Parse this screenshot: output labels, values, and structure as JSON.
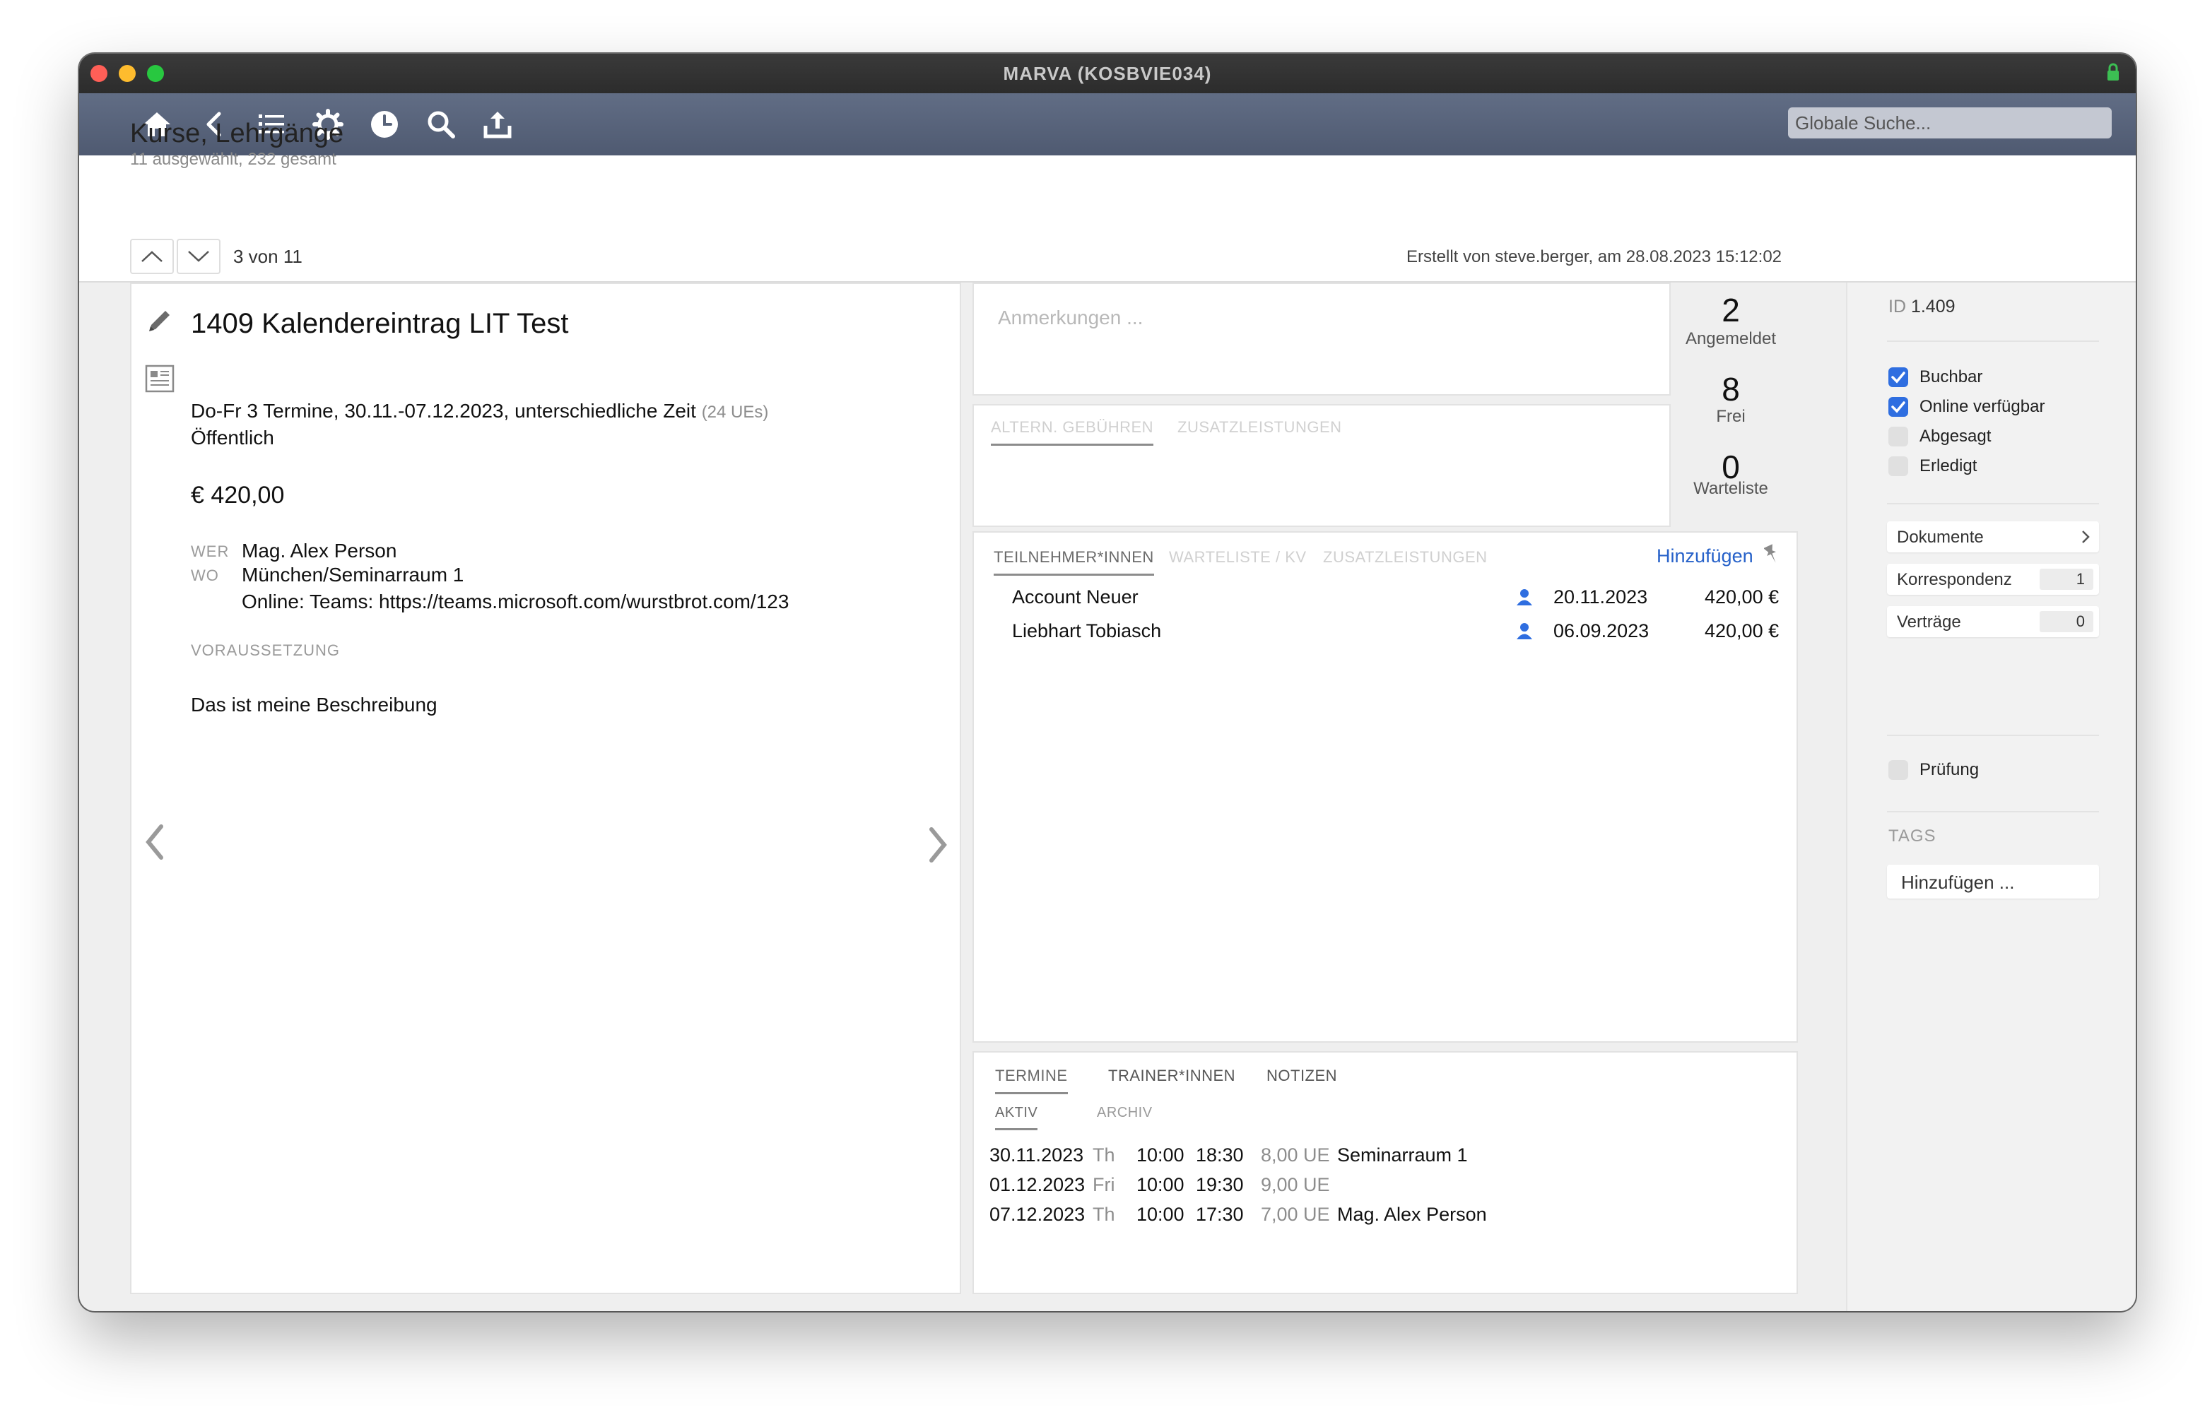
{
  "window": {
    "title": "MARVA (KOSBVIE034)"
  },
  "toolbar": {
    "icons": [
      "home-icon",
      "back-icon",
      "list-icon",
      "gear-icon",
      "clock-icon",
      "search-icon",
      "export-icon"
    ],
    "search_placeholder": "Globale Suche..."
  },
  "header": {
    "title": "Kurse, Lehrgänge",
    "subtitle": "11 ausgewählt, 232 gesamt"
  },
  "nav": {
    "position": "3 von 11",
    "created_by": "Erstellt von steve.berger, am 28.08.2023 15:12:02"
  },
  "course": {
    "title": "1409 Kalendereintrag LIT Test",
    "schedule": "Do-Fr 3 Termine, 30.11.-07.12.2023, unterschiedliche Zeit",
    "units": "(24 UEs)",
    "visibility": "Öffentlich",
    "price": "€ 420,00",
    "wer_label": "WER",
    "wer_value": "Mag. Alex Person",
    "wo_label": "WO",
    "wo_value": "München/Seminarraum 1",
    "online": "Online: Teams: https://teams.microsoft.com/wurstbrot.com/123",
    "prereq_label": "VORAUSSETZUNG",
    "description": "Das ist meine Beschreibung"
  },
  "notes": {
    "placeholder": "Anmerkungen ..."
  },
  "fees_tabs": [
    "ALTERN. GEBÜHREN",
    "ZUSATZLEISTUNGEN"
  ],
  "stats": [
    {
      "value": "2",
      "label": "Angemeldet"
    },
    {
      "value": "8",
      "label": "Frei"
    },
    {
      "value": "0",
      "label": "Warteliste"
    }
  ],
  "participants": {
    "tabs": [
      "TEILNEHMER*INNEN",
      "WARTELISTE / KV",
      "ZUSATZLEISTUNGEN"
    ],
    "add_label": "Hinzufügen",
    "rows": [
      {
        "name": "Account Neuer",
        "date": "20.11.2023",
        "amount": "420,00 €"
      },
      {
        "name": "Liebhart Tobiasch",
        "date": "06.09.2023",
        "amount": "420,00 €"
      }
    ]
  },
  "appointments": {
    "tabs": [
      "TERMINE",
      "TRAINER*INNEN",
      "NOTIZEN"
    ],
    "subtabs": [
      "AKTIV",
      "ARCHIV"
    ],
    "rows": [
      {
        "date": "30.11.2023",
        "day": "Th",
        "start": "10:00",
        "end": "18:30",
        "units": "8,00 UE",
        "info": "Seminarraum 1"
      },
      {
        "date": "01.12.2023",
        "day": "Fri",
        "start": "10:00",
        "end": "19:30",
        "units": "9,00 UE",
        "info": ""
      },
      {
        "date": "07.12.2023",
        "day": "Th",
        "start": "10:00",
        "end": "17:30",
        "units": "7,00 UE",
        "info": "Mag. Alex Person"
      }
    ]
  },
  "sidebar": {
    "id_label": "ID",
    "id_value": "1.409",
    "checkboxes": [
      {
        "label": "Buchbar",
        "checked": true
      },
      {
        "label": "Online verfügbar",
        "checked": true
      },
      {
        "label": "Abgesagt",
        "checked": false
      },
      {
        "label": "Erledigt",
        "checked": false
      }
    ],
    "documents_label": "Dokumente",
    "links": [
      {
        "label": "Korrespondenz",
        "count": "1"
      },
      {
        "label": "Verträge",
        "count": "0"
      }
    ],
    "exam_label": "Prüfung",
    "tags_label": "TAGS",
    "tags_add": "Hinzufügen ..."
  },
  "colors": {
    "accent": "#2661c9",
    "toolbar": "#586379",
    "checkbox": "#2f6ee0"
  }
}
